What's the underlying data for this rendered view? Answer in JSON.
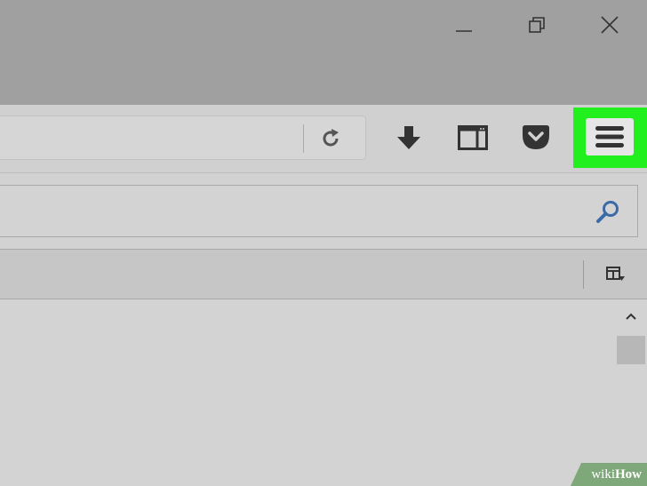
{
  "titlebar": {
    "controls": [
      {
        "name": "minimize",
        "icon": "minimize-icon"
      },
      {
        "name": "restore",
        "icon": "restore-icon"
      },
      {
        "name": "close",
        "icon": "close-icon"
      }
    ]
  },
  "navbar": {
    "url": "",
    "reload_icon": "reload-icon",
    "toolbar": [
      {
        "name": "downloads",
        "icon": "download-arrow-icon"
      },
      {
        "name": "sidebar",
        "icon": "sidebar-window-icon"
      },
      {
        "name": "pocket",
        "icon": "pocket-icon"
      },
      {
        "name": "menu",
        "icon": "hamburger-menu-icon"
      }
    ],
    "highlight_color": "#22ef1e"
  },
  "search": {
    "value": "",
    "icon": "search-icon",
    "icon_color": "#3b6aa8"
  },
  "sidebar_header": {
    "options_icon": "sidebar-options-icon"
  },
  "scrollbar": {
    "up_icon": "chevron-up-icon"
  },
  "watermark": {
    "wiki": "wiki",
    "how": "How"
  }
}
